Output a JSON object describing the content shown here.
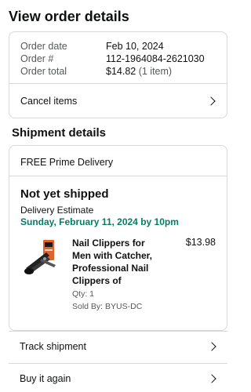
{
  "page": {
    "title": "View order details"
  },
  "summary": {
    "order_date_label": "Order date",
    "order_date": "Feb 10, 2024",
    "order_number_label": "Order #",
    "order_number": "112-1964084-2621030",
    "order_total_label": "Order total",
    "order_total": "$14.82",
    "order_items": "(1 item)",
    "cancel_label": "Cancel items"
  },
  "shipment": {
    "section_title": "Shipment details",
    "prime_label": "FREE Prime Delivery",
    "status": "Not yet shipped",
    "estimate_label": "Delivery Estimate",
    "estimate_date": "Sunday, February 11, 2024 by 10pm"
  },
  "product": {
    "name": "Nail Clippers for Men with Catcher, Professional Nail Clippers of",
    "price": "$13.98",
    "qty": "Qty: 1",
    "sold_by": "Sold By: BYUS-DC",
    "icon": "nail-clipper-product-image"
  },
  "actions": {
    "track_label": "Track shipment",
    "buy_again_label": "Buy it again"
  },
  "colors": {
    "green": "#067d62",
    "border": "#d5d9d9",
    "muted": "#565959"
  }
}
